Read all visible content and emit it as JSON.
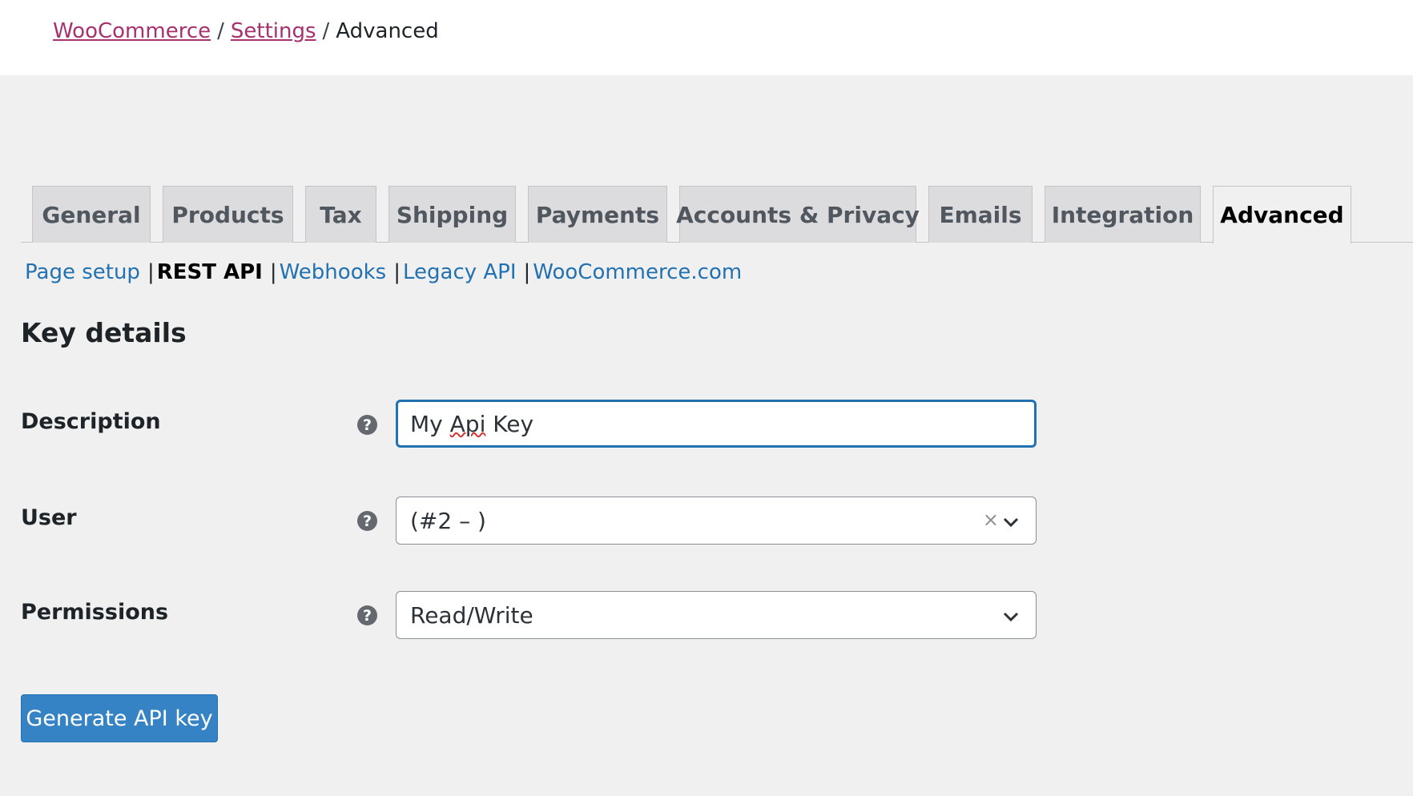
{
  "breadcrumb": {
    "root": "WooCommerce",
    "separator": "/",
    "settings": "Settings",
    "current": "Advanced"
  },
  "tabs": [
    {
      "label": "General"
    },
    {
      "label": "Products"
    },
    {
      "label": "Tax"
    },
    {
      "label": "Shipping"
    },
    {
      "label": "Payments"
    },
    {
      "label": "Accounts & Privacy"
    },
    {
      "label": "Emails"
    },
    {
      "label": "Integration"
    },
    {
      "label": "Advanced",
      "active": true
    }
  ],
  "subnav": {
    "separator": "|",
    "items": [
      "Page setup",
      "REST API",
      "Webhooks",
      "Legacy API",
      "WooCommerce.com"
    ],
    "current": "REST API"
  },
  "section": {
    "title": "Key details"
  },
  "form": {
    "description": {
      "label": "Description",
      "value_prefix": "My ",
      "value_misspelled": "Api",
      "value_suffix": " Key"
    },
    "user": {
      "label": "User",
      "value": "(#2 – )",
      "clear_glyph": "×"
    },
    "permissions": {
      "label": "Permissions",
      "value": "Read/Write"
    },
    "help_glyph": "?"
  },
  "actions": {
    "generate_label": "Generate API key"
  },
  "colors": {
    "link": "#2271b1",
    "breadcrumb_link": "#a7316e",
    "primary_button": "#3582c4",
    "focus_border": "#2271b1"
  }
}
